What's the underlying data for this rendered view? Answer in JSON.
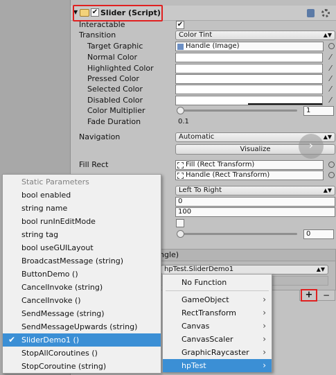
{
  "header": {
    "component_title": "Slider (Script)",
    "fold_arrow": "▼",
    "book_icon": "help-book-icon",
    "gear_icon": "gear-icon"
  },
  "props": {
    "interactable_label": "Interactable",
    "transition_label": "Transition",
    "transition_value": "Color Tint",
    "target_graphic_label": "Target Graphic",
    "target_graphic_value": "Handle (Image)",
    "normal_color_label": "Normal Color",
    "highlighted_color_label": "Highlighted Color",
    "pressed_color_label": "Pressed Color",
    "selected_color_label": "Selected Color",
    "disabled_color_label": "Disabled Color",
    "color_multiplier_label": "Color Multiplier",
    "color_multiplier_value": "1",
    "color_multiplier_level": 0,
    "fade_duration_label": "Fade Duration",
    "fade_duration_value": "0.1",
    "navigation_label": "Navigation",
    "navigation_value": "Automatic",
    "visualize_label": "Visualize",
    "fill_rect_label": "Fill Rect",
    "fill_rect_value": "Fill (Rect Transform)",
    "handle_rect_value": "Handle (Rect Transform)",
    "direction_value": "Left To Right",
    "min_value": "0",
    "max_value": "100",
    "value_value": "0",
    "value_slider_level": 0,
    "event_header_fragment": "ngle)",
    "event_function_fragment": "hpTest.SliderDemo1"
  },
  "left_menu": {
    "header": "Static Parameters",
    "items": [
      "bool enabled",
      "string name",
      "bool runInEditMode",
      "string tag",
      "bool useGUILayout",
      "BroadcastMessage (string)",
      "ButtonDemo ()",
      "CancelInvoke (string)",
      "CancelInvoke ()",
      "SendMessage (string)",
      "SendMessageUpwards (string)",
      "SliderDemo1 ()",
      "StopAllCoroutines ()",
      "StopCoroutine (string)"
    ],
    "selected_index": 11,
    "check_mark": "✔"
  },
  "right_menu": {
    "items": [
      "No Function",
      "GameObject",
      "RectTransform",
      "Canvas",
      "CanvasScaler",
      "GraphicRaycaster",
      "hpTest"
    ],
    "has_submenu": [
      false,
      true,
      true,
      true,
      true,
      true,
      true
    ],
    "selected_index": 6,
    "submenu_arrow": "›"
  },
  "buttons": {
    "add_label": "+",
    "remove_label": "−"
  },
  "colors": {
    "highlight_red": "#e02020",
    "menu_selection": "#3b8fd5"
  }
}
